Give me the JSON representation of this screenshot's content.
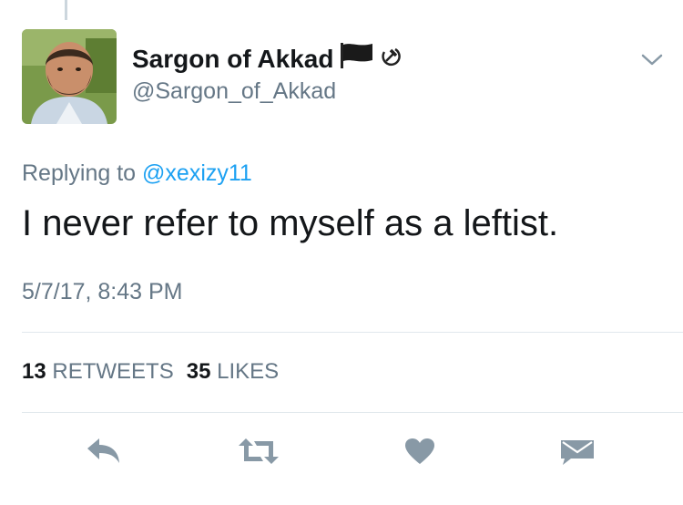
{
  "tweet": {
    "display_name": "Sargon of Akkad",
    "handle": "@Sargon_of_Akkad",
    "replying_prefix": "Replying to ",
    "replying_mention": "@xexizy11",
    "text": "I never refer to myself as a leftist.",
    "timestamp": "5/7/17, 8:43 PM",
    "retweets_count": "13",
    "retweets_label": "RETWEETS",
    "likes_count": "35",
    "likes_label": "LIKES"
  },
  "icons": {
    "name_badges": [
      "black-flag-icon",
      "hammer-and-sickle-icon"
    ],
    "menu": "chevron-down-icon",
    "actions": [
      "reply-icon",
      "retweet-icon",
      "heart-icon",
      "envelope-icon"
    ]
  },
  "colors": {
    "text_primary": "#14171a",
    "text_secondary": "#657786",
    "link": "#1da1f2",
    "icon": "#8899a6",
    "divider": "#e1e8ed"
  }
}
